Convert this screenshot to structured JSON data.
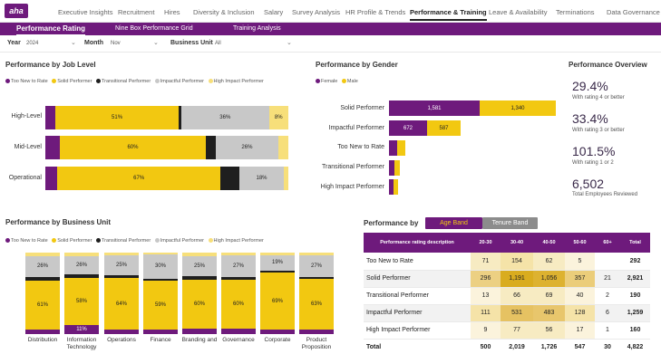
{
  "logo": "aha",
  "nav": {
    "tabs": [
      "Executive Insights",
      "Recruitment",
      "Hires",
      "Diversity & Inclusion",
      "Salary",
      "Survey Analysis",
      "HR Profile & Trends",
      "Performance & Training",
      "Leave & Availability",
      "Terminations",
      "Data Governance"
    ],
    "active": "Performance & Training"
  },
  "subnav": {
    "tabs": [
      "Performance Rating",
      "Nine Box Performance Grid",
      "Training Analysis"
    ],
    "active": "Performance Rating"
  },
  "filters": {
    "year": {
      "label": "Year",
      "value": "2024"
    },
    "month": {
      "label": "Month",
      "value": "Nov"
    },
    "business_unit": {
      "label": "Business Unit",
      "value": "All"
    }
  },
  "colors": {
    "too_new": "#6e1a7c",
    "solid": "#f2c811",
    "transitional": "#1f1f1f",
    "impactful": "#c8c8c8",
    "high_impact": "#f7df7a",
    "female": "#6e1a7c",
    "male": "#f2c811"
  },
  "legend_categories": [
    "Too New to Rate",
    "Solid Performer",
    "Transitional Performer",
    "Impactful Performer",
    "High Impact Performer"
  ],
  "job_level": {
    "title": "Performance by Job Level",
    "rows": [
      {
        "label": "High-Level",
        "labels": [
          "",
          "51%",
          "",
          "36%",
          "8%"
        ]
      },
      {
        "label": "Mid-Level",
        "labels": [
          "",
          "60%",
          "",
          "26%",
          ""
        ]
      },
      {
        "label": "Operational",
        "labels": [
          "",
          "67%",
          "",
          "18%",
          ""
        ]
      }
    ]
  },
  "gender": {
    "title": "Performance by Gender",
    "legend": [
      "Female",
      "Male"
    ],
    "rows": [
      {
        "label": "Solid Performer",
        "female_label": "1,581",
        "male_label": "1,340"
      },
      {
        "label": "Impactful Performer",
        "female_label": "672",
        "male_label": "587"
      },
      {
        "label": "Too New to Rate",
        "female_label": "",
        "male_label": ""
      },
      {
        "label": "Transitional Performer",
        "female_label": "",
        "male_label": ""
      },
      {
        "label": "High Impact Performer",
        "female_label": "",
        "male_label": ""
      }
    ]
  },
  "overview": {
    "title": "Performance Overview",
    "kpis": [
      {
        "value": "29.4%",
        "label": "With rating 4 or better"
      },
      {
        "value": "33.4%",
        "label": "With rating 3 or better"
      },
      {
        "value": "101.5%",
        "label": "With rating 1 or 2"
      },
      {
        "value": "6,502",
        "label": "Total Employees Reviewed"
      }
    ]
  },
  "business_unit": {
    "title": "Performance by Business Unit",
    "units": [
      {
        "name": "Distribution",
        "labels": [
          "",
          "61%",
          "",
          "26%",
          ""
        ]
      },
      {
        "name": "Information Technology",
        "labels": [
          "11%",
          "58%",
          "",
          "26%",
          ""
        ]
      },
      {
        "name": "Operations",
        "labels": [
          "",
          "64%",
          "",
          "25%",
          ""
        ]
      },
      {
        "name": "Finance",
        "labels": [
          "",
          "59%",
          "",
          "30%",
          ""
        ]
      },
      {
        "name": "Branding and",
        "labels": [
          "",
          "60%",
          "",
          "25%",
          ""
        ]
      },
      {
        "name": "Governance",
        "labels": [
          "",
          "60%",
          "",
          "27%",
          ""
        ]
      },
      {
        "name": "Corporate",
        "labels": [
          "",
          "69%",
          "",
          "19%",
          ""
        ]
      },
      {
        "name": "Product Proposition",
        "labels": [
          "",
          "63%",
          "",
          "27%",
          ""
        ]
      }
    ]
  },
  "perf_by": {
    "title": "Performance by",
    "toggle": [
      "Age Band",
      "Tenure Band"
    ],
    "active": "Age Band",
    "table": {
      "headers": [
        "Performance rating description",
        "20-30",
        "30-40",
        "40-50",
        "50-60",
        "60+",
        "Total"
      ],
      "rows": [
        {
          "label": "Too New to Rate",
          "cells": [
            "71",
            "154",
            "62",
            "5",
            ""
          ],
          "total": "292"
        },
        {
          "label": "Solid Performer",
          "cells": [
            "296",
            "1,191",
            "1,056",
            "357",
            "21"
          ],
          "total": "2,921"
        },
        {
          "label": "Transitional Performer",
          "cells": [
            "13",
            "66",
            "69",
            "40",
            "2"
          ],
          "total": "190"
        },
        {
          "label": "Impactful Performer",
          "cells": [
            "111",
            "531",
            "483",
            "128",
            "6"
          ],
          "total": "1,259"
        },
        {
          "label": "High Impact Performer",
          "cells": [
            "9",
            "77",
            "56",
            "17",
            "1"
          ],
          "total": "160"
        }
      ],
      "total_row": {
        "label": "Total",
        "cells": [
          "500",
          "2,019",
          "1,726",
          "547",
          "30"
        ],
        "total": "4,822"
      }
    }
  }
}
